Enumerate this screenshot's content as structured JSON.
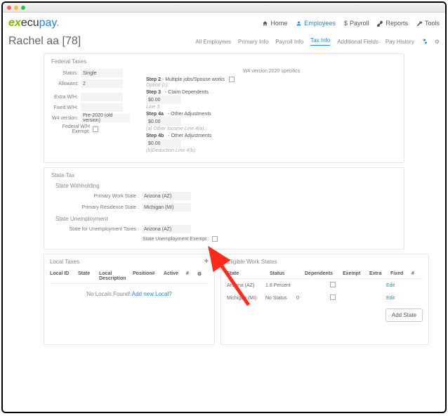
{
  "window": {
    "logo_ex": "ex",
    "logo_ecu": "ecu",
    "logo_pay": "pay",
    "logo_dot": "."
  },
  "nav": {
    "home": "Home",
    "employees": "Employees",
    "payroll": "Payroll",
    "reports": "Reports",
    "tools": "Tools"
  },
  "page": {
    "title": "Rachel aa [78]"
  },
  "tabs": {
    "all": "All Employees",
    "primary": "Primary Info",
    "payroll": "Payroll Info",
    "tax": "Tax Info",
    "add": "Additional Fields",
    "hist": "Pay History"
  },
  "fed": {
    "title": "Federal Taxes",
    "status_lbl": "Status:",
    "status": "Single",
    "allow_lbl": "Allowanc",
    "allow": "2",
    "extra_lbl": "Extra W/H:",
    "extra": "",
    "fixed_lbl": "Fixed W/H:",
    "fixed": "",
    "w4v_lbl": "W4 version:",
    "w4v": "Pre-2020 (old version)",
    "exempt_lbl": "Federal W/H Exempt:",
    "w4_header": "W4 version 2020 specifics",
    "s2": "Step 2",
    "s2t": " - Multiple jobs/Spouse works",
    "s2i": "Option (c):",
    "s3": "Step 3",
    "s3t": " - Claim Dependents",
    "s3v": "$0.00",
    "s3i": "Line 3:",
    "s4a": "Step 4a",
    "s4at": " - Other Adjustments",
    "s4av": "$0.00",
    "s4ai": "(a) Other Income Line 4(a):",
    "s4b": "Step 4b",
    "s4bt": " - Other Adjustments",
    "s4bv": "$0.00",
    "s4bi": "(b)Deduction Line 4(b):"
  },
  "state": {
    "title": "State Tax",
    "wh": "State Withholding",
    "pws_lbl": "Primary Work State :",
    "pws": "Arizona (AZ)",
    "prs_lbl": "Primary Residence State :",
    "prs": "Michigan (MI)",
    "su": "State Unemployment",
    "sut_lbl": "State for Unemployment Taxes :",
    "sut": "Arizona (AZ)",
    "sue_lbl": "State Unemployment Exempt :"
  },
  "local": {
    "title": "Local Taxes",
    "h": {
      "id": "Local ID",
      "state": "State",
      "desc": "Local Description",
      "pos": "Position#",
      "act": "Active",
      "n": "#",
      "g": "⚙"
    },
    "none": "No Locals Found! ",
    "add": "Add new Local?"
  },
  "ews": {
    "title": "Eligible Work States",
    "h": {
      "state": "State",
      "status": "Status",
      "dep": "Dependents",
      "ex": "Exempt",
      "extra": "Extra",
      "fixed": "Fixed",
      "n": "#"
    },
    "r1": {
      "state": "Arizona (AZ)",
      "status": "1.8 Percent",
      "dep": "",
      "edit": "Edit"
    },
    "r2": {
      "state": "Michigan (MI)",
      "status": "No Status",
      "dep": "0",
      "edit": "Edit"
    },
    "addstate": "Add State"
  }
}
